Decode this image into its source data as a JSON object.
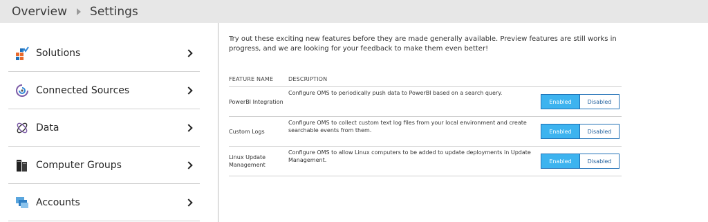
{
  "breadcrumb": {
    "items": [
      "Overview",
      "Settings"
    ]
  },
  "sidebar": {
    "items": [
      {
        "label": "Solutions",
        "icon": "solutions-icon"
      },
      {
        "label": "Connected Sources",
        "icon": "connected-sources-icon"
      },
      {
        "label": "Data",
        "icon": "data-icon"
      },
      {
        "label": "Computer Groups",
        "icon": "computer-groups-icon"
      },
      {
        "label": "Accounts",
        "icon": "accounts-icon"
      }
    ]
  },
  "preview": {
    "intro": "Try out these exciting new features before they are made generally available. Preview features are still works in progress, and we are looking for your feedback to make them even better!",
    "headers": {
      "name": "FEATURE NAME",
      "description": "DESCRIPTION"
    },
    "features": [
      {
        "name": "PowerBI Integration",
        "description": "Configure OMS to periodically push data to PowerBI based on a search query.",
        "enabled_label": "Enabled",
        "disabled_label": "Disabled",
        "state": "Enabled"
      },
      {
        "name": "Custom Logs",
        "description": "Configure OMS to collect custom text log files from your local environment and create searchable events from them.",
        "enabled_label": "Enabled",
        "disabled_label": "Disabled",
        "state": "Enabled"
      },
      {
        "name": "Linux Update Management",
        "description": "Configure OMS to allow Linux computers to be added to update deployments in Update Management.",
        "enabled_label": "Enabled",
        "disabled_label": "Disabled",
        "state": "Enabled"
      }
    ]
  },
  "colors": {
    "toggle_active": "#3db3ef",
    "toggle_border": "#1e6fb5",
    "topbar": "#e7e7e7"
  }
}
